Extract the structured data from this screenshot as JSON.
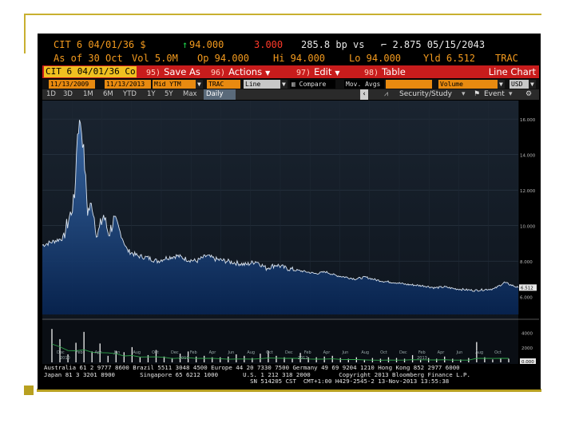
{
  "header": {
    "security": "CIT 6 04/01/36 $",
    "arrow": "↑",
    "price": "94.000",
    "change": "3.000",
    "spread": "285.8 bp vs",
    "spread_ref": "⌐ 2.875 05/15/2043",
    "as_of": "As of 30 Oct",
    "vol": "Vol 5.0M",
    "op": "Op 94.000",
    "hi": "Hi 94.000",
    "lo": "Lo 94.000",
    "yld": "Yld 6.512",
    "source": "TRAC"
  },
  "toolbar": {
    "security_field": "CIT 6 04/01/36 Co",
    "save_as": {
      "key": "95)",
      "label": "Save As"
    },
    "actions": {
      "key": "96)",
      "label": "Actions"
    },
    "edit": {
      "key": "97)",
      "label": "Edit"
    },
    "table": {
      "key": "98)",
      "label": "Table"
    },
    "chart_type": "Line Chart"
  },
  "options": {
    "start_date": "11/13/2009",
    "end_date": "11/13/2013",
    "field": "Mid YTM",
    "source": "TRAC",
    "chart_style": "Line",
    "compare": "Compare",
    "mov_avgs": "Mov. Avgs",
    "volume": "Volume",
    "currency": "USD"
  },
  "periods": [
    "1D",
    "3D",
    "1M",
    "6M",
    "YTD",
    "1Y",
    "5Y",
    "Max",
    "Daily"
  ],
  "period_active": "Daily",
  "period_right": {
    "security_study": "Security/Study",
    "event": "Event"
  },
  "axis": {
    "price_ticks": [
      "16.000",
      "14.000",
      "12.000",
      "10.000",
      "8.000",
      "6.000"
    ],
    "last_value": "6.512",
    "volume_ticks": [
      "4000",
      "2000",
      "0.000"
    ],
    "x_labels": [
      "Dec",
      "Feb",
      "Apr",
      "Jun",
      "Aug",
      "Oct",
      "Dec",
      "Feb",
      "Apr",
      "Jun",
      "Aug",
      "Oct",
      "Dec",
      "Feb",
      "Apr",
      "Jun",
      "Aug",
      "Oct",
      "Dec",
      "Feb",
      "Apr",
      "Jun",
      "Aug",
      "Oct"
    ],
    "year_labels": [
      "2010",
      "2011",
      "2012",
      "2013"
    ]
  },
  "footer": {
    "line1": "Australia 61 2 9777 8600 Brazil 5511 3048 4500 Europe 44 20 7330 7500 Germany 49 69 9204 1210 Hong Kong 852 2977 6000",
    "line2": "Japan 81 3 3201 8900       Singapore 65 6212 1000       U.S. 1 212 318 2000        Copyright 2013 Bloomberg Finance L.P.",
    "line3": "                                                          SN 514205 CST  CMT+1:00 H429-2545-2 13-Nov-2013 13:55:38"
  },
  "chart_data": {
    "type": "area",
    "title": "",
    "xlabel": "",
    "ylabel": "",
    "x_range": [
      "2009-11-13",
      "2013-11-13"
    ],
    "ylim": [
      5.0,
      16.5
    ],
    "series": [
      {
        "x": [
          "2009-11-13",
          "2009-12-15",
          "2010-01-15",
          "2010-02-10",
          "2010-02-20",
          "2010-03-01",
          "2010-03-10",
          "2010-03-20",
          "2010-04-01",
          "2010-04-15",
          "2010-05-01",
          "2010-05-20",
          "2010-06-05",
          "2010-06-20",
          "2010-07-10",
          "2010-08-01",
          "2010-09-01",
          "2010-10-01",
          "2010-11-01",
          "2010-12-01",
          "2011-01-01",
          "2011-02-01",
          "2011-03-01",
          "2011-04-01",
          "2011-05-01",
          "2011-06-01",
          "2011-07-01",
          "2011-08-01",
          "2011-09-01",
          "2011-10-01",
          "2011-11-01",
          "2011-12-01",
          "2012-01-01",
          "2012-02-01",
          "2012-03-01",
          "2012-04-01",
          "2012-05-01",
          "2012-06-01",
          "2012-07-01",
          "2012-08-01",
          "2012-09-01",
          "2012-10-01",
          "2012-11-01",
          "2012-12-01",
          "2013-01-01",
          "2013-02-01",
          "2013-03-01",
          "2013-04-01",
          "2013-05-01",
          "2013-06-01",
          "2013-07-01",
          "2013-08-01",
          "2013-09-01",
          "2013-10-01",
          "2013-11-13"
        ],
        "values": [
          8.9,
          9.1,
          9.3,
          10.8,
          11.6,
          15.3,
          15.9,
          14.2,
          10.8,
          11.2,
          9.4,
          10.6,
          9.5,
          10.3,
          9.6,
          8.6,
          8.3,
          8.2,
          8.0,
          8.2,
          8.3,
          8.1,
          8.0,
          8.3,
          8.1,
          8.0,
          7.9,
          7.8,
          8.0,
          7.6,
          7.8,
          7.6,
          7.5,
          7.4,
          7.3,
          7.4,
          7.2,
          7.1,
          7.0,
          7.1,
          6.95,
          6.85,
          6.8,
          6.7,
          6.65,
          6.6,
          6.5,
          6.55,
          6.45,
          6.4,
          6.35,
          6.4,
          6.45,
          6.8,
          6.512
        ]
      }
    ],
    "volume": {
      "ylim": [
        0,
        5500
      ],
      "values": [
        4600,
        3200,
        1100,
        2700,
        4200,
        1500,
        2600,
        900,
        1600,
        1400,
        2100,
        700,
        1000,
        1700,
        800,
        600,
        1200,
        1500,
        800,
        900,
        700,
        700,
        800,
        1100,
        900,
        600,
        1200,
        1600,
        900,
        700,
        600,
        1300,
        700,
        700,
        800,
        900,
        600,
        500,
        700,
        400,
        600,
        500,
        700,
        600,
        500,
        1000,
        400,
        600,
        500,
        800,
        500,
        400,
        600,
        2800,
        700,
        400,
        600,
        500
      ],
      "moving_average_color": "#2fa64b"
    }
  }
}
